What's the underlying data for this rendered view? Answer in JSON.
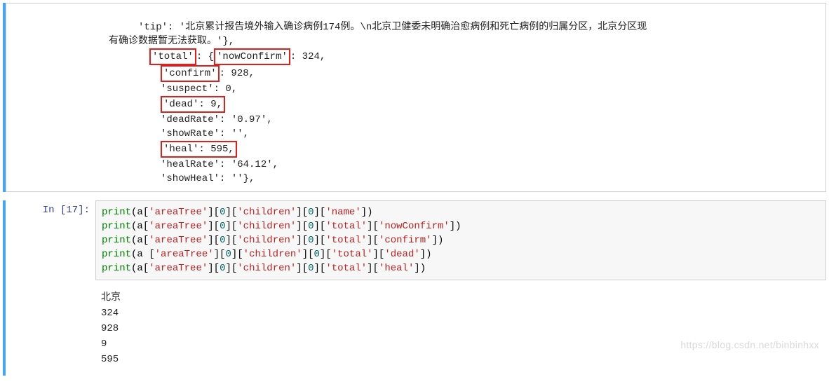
{
  "upper_output": {
    "tip_line": "'tip': '北京累计报告境外输入确诊病例174例。\\n北京卫健委未明确治愈病例和死亡病例的归属分区，北京分区现",
    "tip_line2": "有确诊数据暂无法获取。'},",
    "total_key": "'total'",
    "nowconfirm_key": "'nowConfirm'",
    "nowconfirm_val": ": 324,",
    "confirm_key": "'confirm'",
    "confirm_val": ": 928,",
    "suspect_line": "'suspect': 0,",
    "dead_key": "'dead': 9,",
    "deadrate_line": "'deadRate': '0.97',",
    "showrate_line": "'showRate': '',",
    "heal_key": "'heal': 595,",
    "healrate_line": "'healRate': '64.12',",
    "showheal_line": "'showHeal': ''},"
  },
  "input_cell": {
    "prompt_label": "In  [17]:",
    "line1": {
      "func": "print",
      "p1": "(a[",
      "s1": "'areaTree'",
      "p2": "][",
      "n1": "0",
      "p3": "][",
      "s2": "'children'",
      "p4": "][",
      "n2": "0",
      "p5": "][",
      "s3": "'name'",
      "p6": "])"
    },
    "line2": {
      "func": "print",
      "p1": "(a[",
      "s1": "'areaTree'",
      "p2": "][",
      "n1": "0",
      "p3": "][",
      "s2": "'children'",
      "p4": "][",
      "n2": "0",
      "p5": "][",
      "s3": "'total'",
      "p6": "][",
      "s4": "'nowConfirm'",
      "p7": "])"
    },
    "line3": {
      "func": "print",
      "p1": "(a[",
      "s1": "'areaTree'",
      "p2": "][",
      "n1": "0",
      "p3": "][",
      "s2": "'children'",
      "p4": "][",
      "n2": "0",
      "p5": "][",
      "s3": "'total'",
      "p6": "][",
      "s4": "'confirm'",
      "p7": "])"
    },
    "line4": {
      "func": "print",
      "p1": "(a [",
      "s1": "'areaTree'",
      "p2": "][",
      "n1": "0",
      "p3": "][",
      "s2": "'children'",
      "p4": "][",
      "n2": "0",
      "p5": "][",
      "s3": "'total'",
      "p6": "][",
      "s4": "'dead'",
      "p7": "])"
    },
    "line5": {
      "func": "print",
      "p1": "(a[",
      "s1": "'areaTree'",
      "p2": "][",
      "n1": "0",
      "p3": "][",
      "s2": "'children'",
      "p4": "][",
      "n2": "0",
      "p5": "][",
      "s3": "'total'",
      "p6": "][",
      "s4": "'heal'",
      "p7": "])"
    }
  },
  "output_result": {
    "l1": "北京",
    "l2": "324",
    "l3": "928",
    "l4": "9",
    "l5": "595"
  },
  "watermark_text": "https://blog.csdn.net/binbinhxx"
}
